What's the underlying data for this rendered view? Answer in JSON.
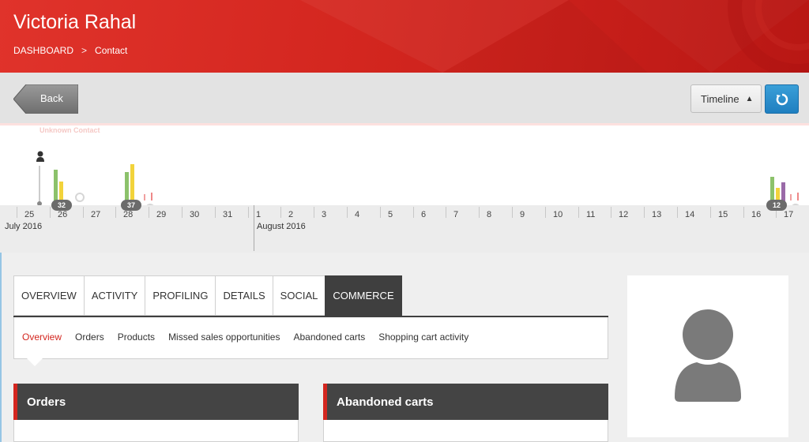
{
  "header": {
    "title": "Victoria Rahal",
    "breadcrumb": [
      "DASHBOARD",
      ">",
      "Contact"
    ]
  },
  "toolbar": {
    "back_label": "Back",
    "timeline_label": "Timeline",
    "timeline_arrow": "▲",
    "refresh_icon": "refresh-icon"
  },
  "timeline": {
    "unknown_label": "Unknown Contact",
    "months": [
      "July 2016",
      "August 2016"
    ],
    "days": [
      "25",
      "26",
      "27",
      "28",
      "29",
      "30",
      "31",
      "1",
      "2",
      "3",
      "4",
      "5",
      "6",
      "7",
      "8",
      "9",
      "10",
      "11",
      "12",
      "13",
      "14",
      "15",
      "16",
      "17"
    ],
    "badges": [
      "32",
      "37",
      "12"
    ]
  },
  "tabs": [
    "OVERVIEW",
    "ACTIVITY",
    "PROFILING",
    "DETAILS",
    "SOCIAL",
    "COMMERCE"
  ],
  "subnav": [
    "Overview",
    "Orders",
    "Products",
    "Missed sales opportunities",
    "Abandoned carts",
    "Shopping cart activity"
  ],
  "panels": {
    "orders_title": "Orders",
    "abandoned_title": "Abandoned carts"
  },
  "colors": {
    "brand_red": "#d3261f",
    "accent_blue": "#1f7fc0",
    "bar_green": "#8cc26b",
    "bar_yellow": "#f2d33b",
    "bar_purple": "#9a6aa8"
  }
}
